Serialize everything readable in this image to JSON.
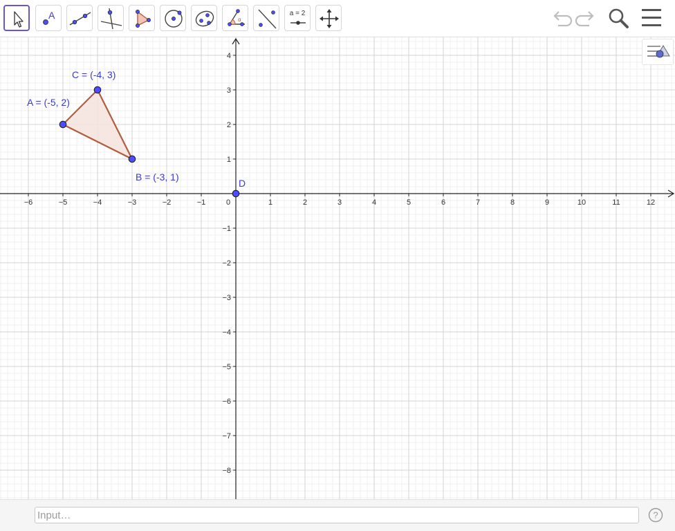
{
  "toolbar": {
    "tools": [
      {
        "name": "move-tool",
        "icon": "cursor-arrow-icon",
        "selected": true
      },
      {
        "name": "point-tool",
        "icon": "point-icon",
        "label": "A"
      },
      {
        "name": "line-tool",
        "icon": "line-through-points-icon"
      },
      {
        "name": "perpendicular-line-tool",
        "icon": "perpendicular-line-icon"
      },
      {
        "name": "polygon-tool",
        "icon": "polygon-icon"
      },
      {
        "name": "circle-center-point-tool",
        "icon": "circle-with-center-icon"
      },
      {
        "name": "ellipse-tool",
        "icon": "ellipse-icon"
      },
      {
        "name": "angle-tool",
        "icon": "angle-icon",
        "label": "α"
      },
      {
        "name": "reflect-tool",
        "icon": "reflect-about-line-icon"
      },
      {
        "name": "slider-tool",
        "icon": "slider-icon",
        "label": "a = 2"
      },
      {
        "name": "move-graphics-view-tool",
        "icon": "move-view-arrows-icon"
      }
    ],
    "right_icons": [
      "undo-icon",
      "redo-icon",
      "search-icon",
      "menu-icon"
    ]
  },
  "graphics": {
    "x_axis_ticks": [
      "−6",
      "−5",
      "−4",
      "−3",
      "−2",
      "−1",
      "0",
      "1",
      "2",
      "3",
      "4",
      "5",
      "6",
      "7",
      "8",
      "9",
      "10",
      "11",
      "12"
    ],
    "y_axis_ticks": [
      "4",
      "3",
      "2",
      "1",
      "−1",
      "−2",
      "−3",
      "−4",
      "−5",
      "−6",
      "−7",
      "−8"
    ],
    "points": [
      {
        "name": "A",
        "x": -5,
        "y": 2,
        "label": "A = (-5, 2)"
      },
      {
        "name": "B",
        "x": -3,
        "y": 1,
        "label": "B = (-3, 1)"
      },
      {
        "name": "C",
        "x": -4,
        "y": 3,
        "label": "C = (-4, 3)"
      },
      {
        "name": "D",
        "x": 0,
        "y": 0,
        "label": "D"
      }
    ],
    "polygon": [
      "A",
      "B",
      "C"
    ],
    "colors": {
      "point_fill": "#4d4dff",
      "point_label": "#3a3ad6",
      "polygon_stroke": "#b35c3c",
      "polygon_fill": "#f6e3dd",
      "selected_tool_border": "#6557d2"
    }
  },
  "style_bar": {
    "icon": "graphics-style-bar-icon"
  },
  "input_bar": {
    "placeholder": "Input…",
    "help_icon": "help-icon"
  }
}
